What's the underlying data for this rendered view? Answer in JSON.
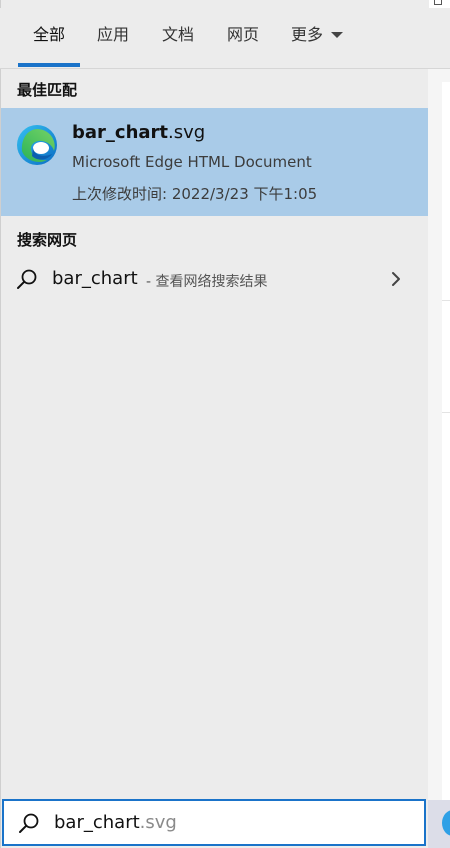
{
  "tabs": [
    {
      "label": "全部",
      "active": true
    },
    {
      "label": "应用",
      "active": false
    },
    {
      "label": "文档",
      "active": false
    },
    {
      "label": "网页",
      "active": false
    },
    {
      "label": "更多",
      "active": false
    }
  ],
  "best_match": {
    "section_title": "最佳匹配",
    "name_bold": "bar_chart",
    "name_ext": ".svg",
    "type": "Microsoft Edge HTML Document",
    "modified": "上次修改时间: 2022/3/23 下午1:05",
    "icon": "edge-icon"
  },
  "web_search": {
    "section_title": "搜索网页",
    "query": "bar_chart",
    "hint": " - 查看网络搜索结果",
    "icon": "search-icon"
  },
  "search_box": {
    "typed": "bar_chart",
    "completion": ".svg",
    "icon": "search-icon"
  },
  "colors": {
    "accent": "#1a73c9",
    "selected_bg": "#a9cbe8",
    "panel_bg": "#ececec"
  }
}
